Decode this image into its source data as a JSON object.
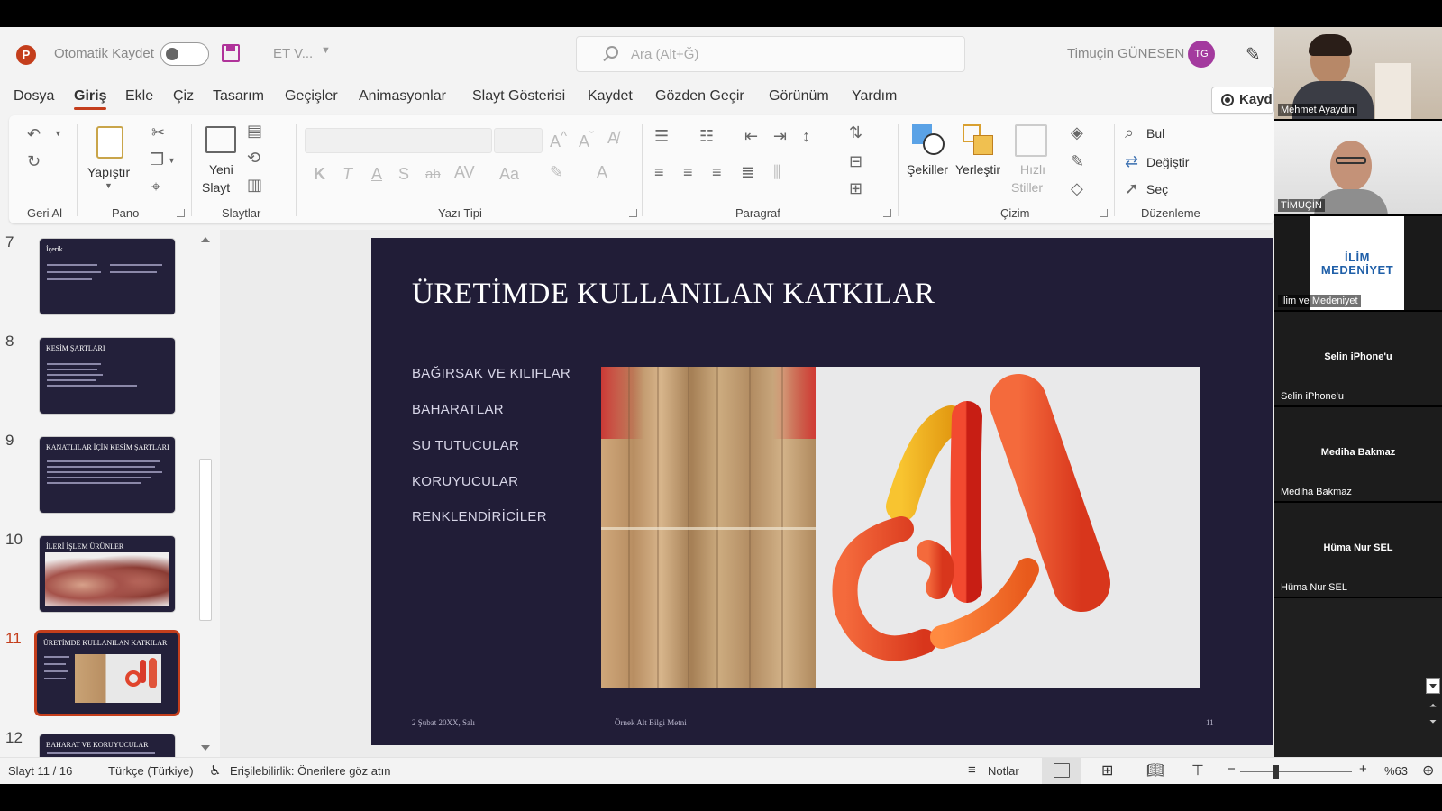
{
  "titlebar": {
    "autosave_label": "Otomatik Kaydet",
    "doc_name": "ET V...",
    "search_placeholder": "Ara (Alt+Ğ)",
    "user_name": "Timuçin GÜNESEN",
    "avatar_initials": "TG"
  },
  "menu": {
    "items": [
      "Dosya",
      "Giriş",
      "Ekle",
      "Çiz",
      "Tasarım",
      "Geçişler",
      "Animasyonlar",
      "Slayt Gösterisi",
      "Kaydet",
      "Gözden Geçir",
      "Görünüm",
      "Yardım"
    ],
    "active": "Giriş",
    "record_label": "Kaydet"
  },
  "ribbon": {
    "groups": [
      "Geri Al",
      "Pano",
      "Slaytlar",
      "Yazı Tipi",
      "Paragraf",
      "Çizim",
      "Düzenleme"
    ],
    "paste_label": "Yapıştır",
    "new_slide_label": [
      "Yeni",
      "Slayt"
    ],
    "shapes_label": "Şekiller",
    "arrange_label": "Yerleştir",
    "quick_styles_label": [
      "Hızlı",
      "Stiller"
    ],
    "find_label": "Bul",
    "replace_label": "Değiştir",
    "select_label": "Seç",
    "font_buttons": [
      "K",
      "T",
      "A",
      "S",
      "ab"
    ]
  },
  "thumbnails": [
    {
      "num": "7",
      "title": "İçerik"
    },
    {
      "num": "8",
      "title": "KESİM ŞARTLARI"
    },
    {
      "num": "9",
      "title": "KANATLILAR İÇİN KESİM ŞARTLARI"
    },
    {
      "num": "10",
      "title": "İLERİ İŞLEM ÜRÜNLER"
    },
    {
      "num": "11",
      "title": "ÜRETİMDE KULLANILAN KATKILAR"
    },
    {
      "num": "12",
      "title": "BAHARAT VE KORUYUCULAR"
    }
  ],
  "slide": {
    "title": "ÜRETİMDE KULLANILAN KATKILAR",
    "bullets": [
      "BAĞIRSAK VE KILIFLAR",
      "BAHARATLAR",
      "SU TUTUCULAR",
      "KORUYUCULAR",
      "RENKLENDİRİCİLER"
    ],
    "footer_date": "2 Şubat 20XX, Salı",
    "footer_text": "Örnek Alt Bilgi Metni",
    "page_number": "11"
  },
  "participants": [
    {
      "name": "Mehmet Ayaydın",
      "type": "video"
    },
    {
      "name": "TİMUÇİN",
      "type": "video"
    },
    {
      "name": "İlim ve Medeniyet",
      "type": "logo",
      "logo_text": [
        "İLİM",
        "MEDENİYET"
      ]
    },
    {
      "name": "Selin iPhone'u",
      "type": "name"
    },
    {
      "name": "Mediha Bakmaz",
      "type": "name"
    },
    {
      "name": "Hüma Nur SEL",
      "type": "name"
    }
  ],
  "statusbar": {
    "slide_info": "Slayt 11 / 16",
    "language": "Türkçe (Türkiye)",
    "accessibility": "Erişilebilirlik: Önerilere göz atın",
    "notes_label": "Notlar",
    "zoom": "%63"
  },
  "colors": {
    "accent": "#c43e1c",
    "slide_bg": "#211d37",
    "avatar": "#a33a9e"
  }
}
